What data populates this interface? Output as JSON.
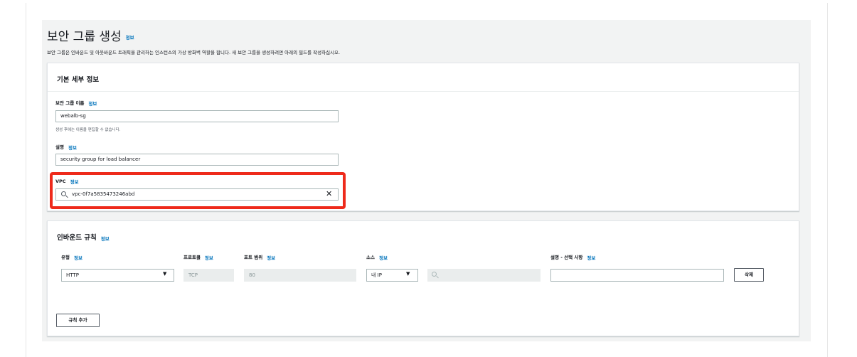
{
  "page": {
    "title": "보안 그룹 생성",
    "info": "정보",
    "description": "보안 그룹은 인바운드 및 아웃바운드 트래픽을 관리하는 인스턴스의 가상 방화벽 역할을 합니다. 새 보안 그룹을 생성하려면 아래의 필드를 작성하십시오."
  },
  "basic": {
    "title": "기본 세부 정보",
    "name_label": "보안 그룹 이름",
    "name_value": "webalb-sg",
    "name_hint": "생성 후에는 이름을 편집할 수 없습니다.",
    "desc_label": "설명",
    "desc_value": "security group for load balancer",
    "vpc_label": "VPC",
    "vpc_value": "vpc-0f7a5835473246abd",
    "info": "정보"
  },
  "inbound": {
    "title": "인바운드 규칙",
    "info": "정보",
    "columns": {
      "type": "유형",
      "protocol": "프로토콜",
      "port_range": "포트 범위",
      "source": "소스",
      "description": "설명 - 선택 사항"
    },
    "row": {
      "type": "HTTP",
      "protocol": "TCP",
      "port": "80",
      "source": "내 IP",
      "source_search": "",
      "description": ""
    },
    "delete_label": "삭제",
    "add_rule_label": "규칙 추가"
  },
  "colors": {
    "highlight": "#ee2a1b",
    "link": "#0073bb",
    "canvas": "#f2f3f3"
  }
}
